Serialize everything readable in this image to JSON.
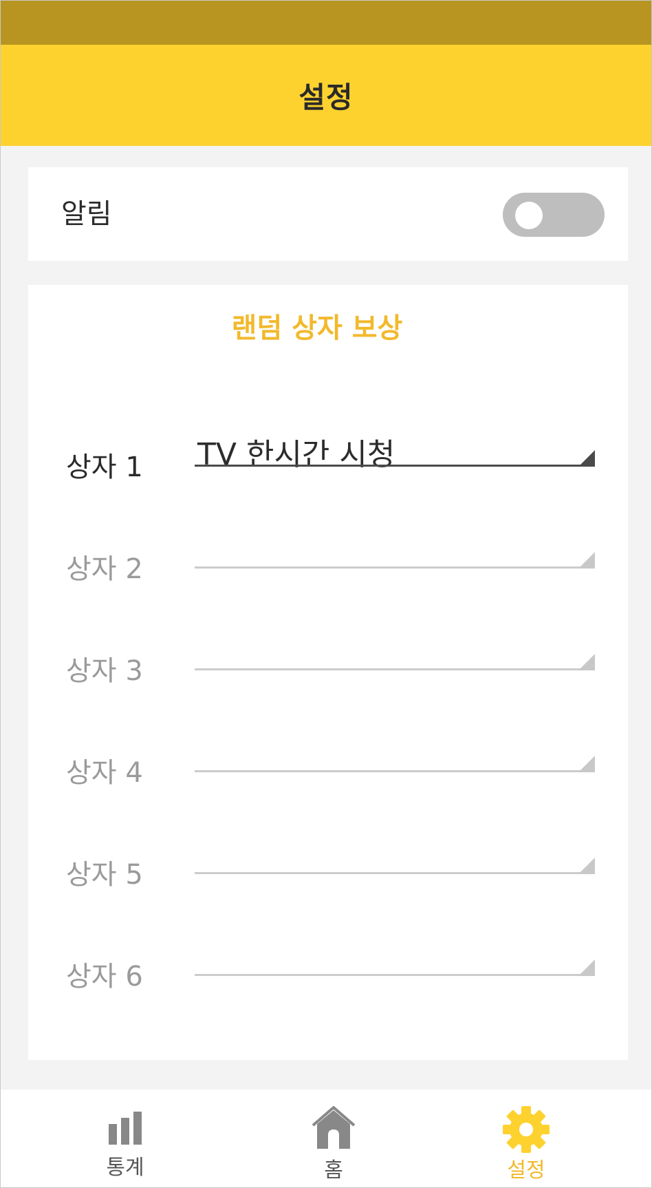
{
  "header": {
    "title": "설정"
  },
  "alarm": {
    "label": "알림",
    "toggle_on": false
  },
  "reward": {
    "title": "랜덤 상자 보상",
    "boxes": [
      {
        "label": "상자 1",
        "value": "TV 한시간 시청"
      },
      {
        "label": "상자 2",
        "value": ""
      },
      {
        "label": "상자 3",
        "value": ""
      },
      {
        "label": "상자 4",
        "value": ""
      },
      {
        "label": "상자 5",
        "value": ""
      },
      {
        "label": "상자 6",
        "value": ""
      }
    ]
  },
  "nav": {
    "items": [
      {
        "label": "통계",
        "icon": "bar-chart-icon"
      },
      {
        "label": "홈",
        "icon": "home-icon"
      },
      {
        "label": "설정",
        "icon": "gear-icon"
      }
    ],
    "active": "설정"
  },
  "colors": {
    "status_bar": "#b79520",
    "header": "#fdd22f",
    "accent": "#f2b92c",
    "toggle_off": "#bebebe"
  }
}
